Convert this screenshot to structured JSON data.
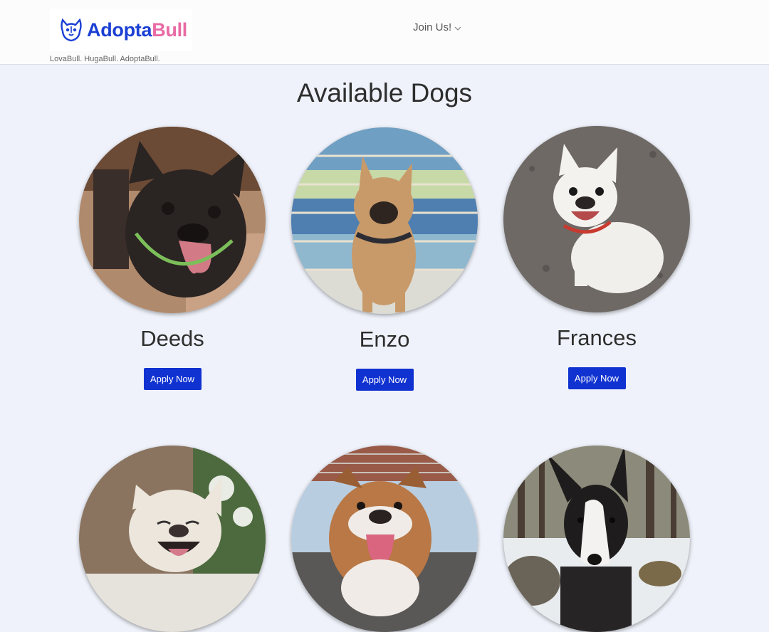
{
  "brand": {
    "name_part1": "Adopta",
    "name_part2": "Bull",
    "tagline": "LovaBull. HugaBull. AdoptaBull.",
    "color_primary": "#1b3fd4",
    "color_accent": "#e86aa4"
  },
  "nav": {
    "join_label": "Join Us!",
    "join_icon": "chevron-down-icon"
  },
  "page": {
    "title": "Available Dogs"
  },
  "dogs": [
    {
      "name": "Deeds",
      "button": "Apply Now",
      "photo": "black brindle french bulldog"
    },
    {
      "name": "Enzo",
      "button": "Apply Now",
      "photo": "fawn french bulldog on mosaic stairs"
    },
    {
      "name": "Frances",
      "button": "Apply Now",
      "photo": "white french bulldog on sand"
    },
    {
      "photo": "cream french bulldog"
    },
    {
      "photo": "english bulldog"
    },
    {
      "photo": "black and white bull terrier in snow"
    }
  ],
  "colors": {
    "button": "#1032d1",
    "background": "#eff2fa"
  }
}
